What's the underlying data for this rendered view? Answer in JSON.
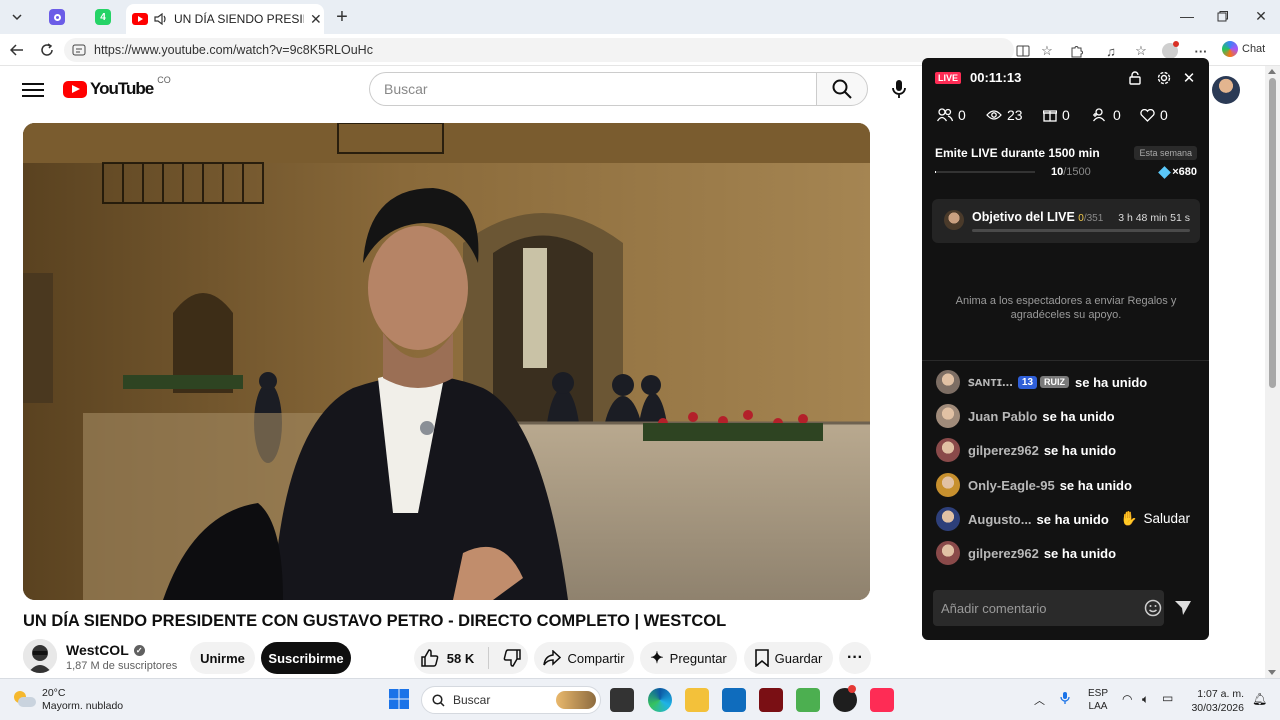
{
  "browser": {
    "tab_title": "UN DÍA SIENDO PRESIDENTE",
    "tab_badge": "4",
    "url": "https://www.youtube.com/watch?v=9c8K5RLOuHc",
    "chat_label": "Chat"
  },
  "youtube": {
    "logo_text": "YouTube",
    "country_code": "CO",
    "search_placeholder": "Buscar",
    "video_title": "UN DÍA SIENDO PRESIDENTE CON GUSTAVO PETRO - DIRECTO COMPLETO | WESTCOL",
    "channel_name": "WestCOL",
    "subscribers": "1,87 M de suscriptores",
    "join_label": "Unirme",
    "subscribe_label": "Suscribirme",
    "likes": "58 K",
    "share_label": "Compartir",
    "ask_label": "Preguntar",
    "save_label": "Guardar"
  },
  "live": {
    "badge": "LIVE",
    "timer": "00:11:13",
    "stats": {
      "followers": "0",
      "viewers": "23",
      "gifts": "0",
      "new_followers": "0",
      "likes": "0"
    },
    "weekly_goal": {
      "title": "Emite LIVE durante 1500 min",
      "chip": "Esta semana",
      "progress_current": "10",
      "progress_total": "/1500",
      "progress_fraction": 0.0067,
      "reward": "×680"
    },
    "live_goal": {
      "title": "Objetivo del LIVE",
      "count_current": "0",
      "count_total": "/351",
      "time_left": "3 h 48 min 51 s",
      "progress_fraction": 0
    },
    "gift_hint": "Anima a los espectadores a enviar Regalos y agradéceles su apoyo.",
    "joins": [
      {
        "user": "ꜱᴀɴᴛɪ...",
        "level": "13",
        "fan_badge": "RUIZ",
        "action": "se ha unido",
        "color": "#7d6e64"
      },
      {
        "user": "Juan Pablo",
        "action": "se ha unido",
        "color": "#a08b7a"
      },
      {
        "user": "gilperez962",
        "action": "se ha unido",
        "color": "#8a4a4a"
      },
      {
        "user": "Only-Eagle-95",
        "action": "se ha unido",
        "color": "#c7902e"
      },
      {
        "user": "Augusto...",
        "action": "se ha unido",
        "color": "#2d3f7a"
      },
      {
        "user": "gilperez962",
        "action": "se ha unido",
        "color": "#8a4a4a"
      }
    ],
    "greet_label": "Saludar",
    "comment_placeholder": "Añadir comentario"
  },
  "taskbar": {
    "temperature": "20°C",
    "weather_text": "Mayorm. nublado",
    "search_placeholder": "Buscar",
    "lang_line1": "ESP",
    "lang_line2": "LAA",
    "time": "1:07 a. m.",
    "date": "30/03/2026"
  }
}
